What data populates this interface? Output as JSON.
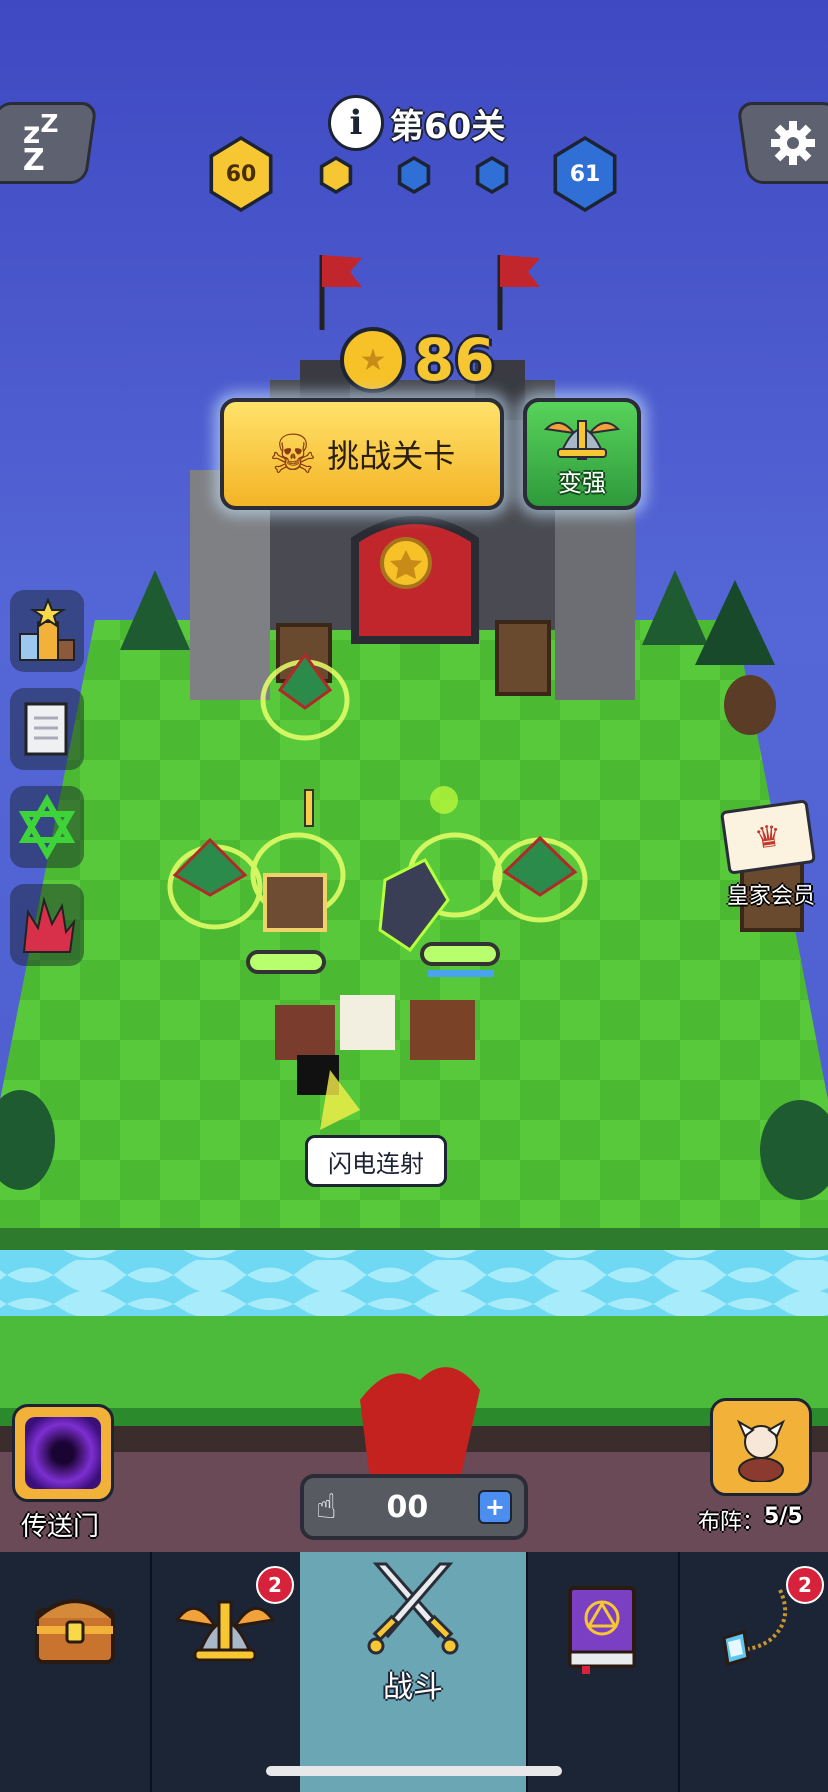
{
  "header": {
    "info_icon": "info-icon",
    "level_label": "第60关",
    "current_level": "60",
    "next_level": "61",
    "sleep_icon": "zzz-icon",
    "settings_icon": "gear-icon",
    "progress_dots": [
      "filled",
      "empty",
      "empty"
    ]
  },
  "reward": {
    "coins": "86"
  },
  "actions": {
    "challenge_label": "挑战关卡",
    "upgrade_label": "变强"
  },
  "side_menu": [
    "trophy-icon",
    "scroll-icon",
    "hexagram-icon",
    "claw-icon"
  ],
  "royal": {
    "label": "皇家会员"
  },
  "skill_tag": "闪电连射",
  "portal": {
    "label": "传送门"
  },
  "formation": {
    "label": "布阵：",
    "value": "5/5"
  },
  "tap_counter": {
    "value": "00"
  },
  "bottom_nav": [
    {
      "icon": "treasure-chest-icon",
      "label": "",
      "badge": ""
    },
    {
      "icon": "winged-helmet-icon",
      "label": "",
      "badge": "2"
    },
    {
      "icon": "crossed-swords-icon",
      "label": "战斗",
      "badge": ""
    },
    {
      "icon": "spellbook-icon",
      "label": "",
      "badge": ""
    },
    {
      "icon": "amulet-icon",
      "label": "",
      "badge": "2"
    }
  ],
  "colors": {
    "accent_gold": "#f7c733",
    "level_blue": "#2f6fd6",
    "grass": "#4fc63a",
    "river": "#6fd8f2",
    "nav_active": "#6aa6b4"
  }
}
